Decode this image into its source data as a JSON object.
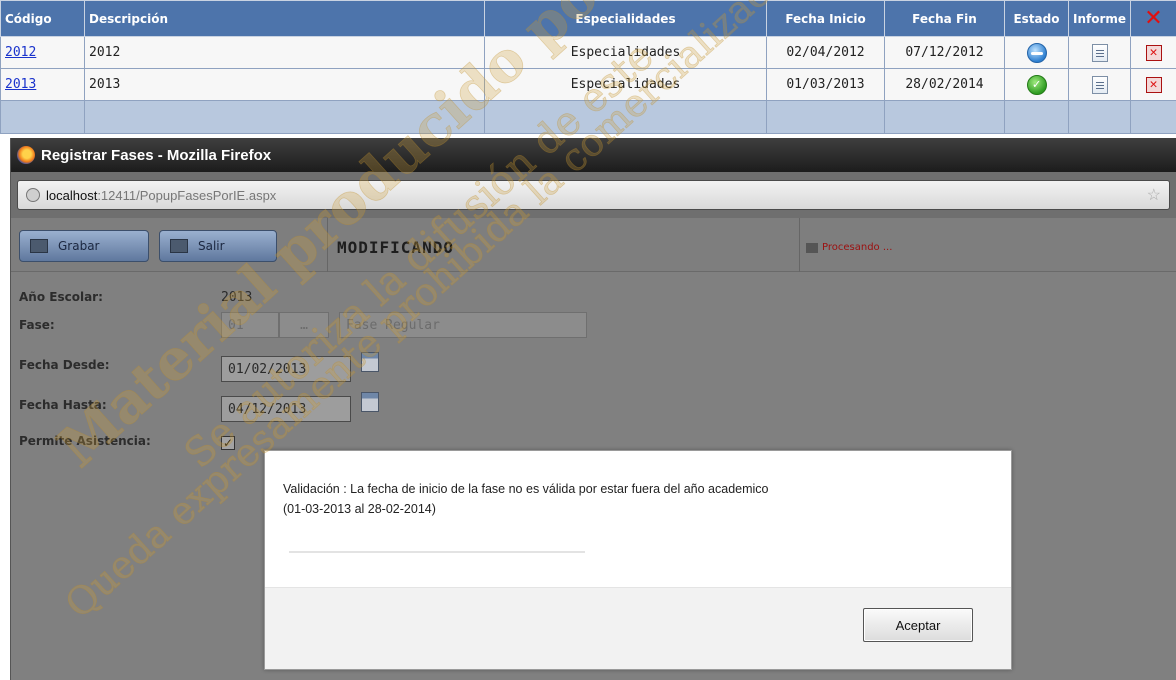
{
  "grid": {
    "headers": {
      "codigo": "Código",
      "descripcion": "Descripción",
      "especialidades": "Especialidades",
      "fecha_inicio": "Fecha Inicio",
      "fecha_fin": "Fecha Fin",
      "estado": "Estado",
      "informe": "Informe"
    },
    "rows": [
      {
        "codigo": "2012",
        "descripcion": "2012",
        "especialidades": "Especialidades",
        "fecha_inicio": "02/04/2012",
        "fecha_fin": "07/12/2012",
        "estado_icon": "blue-minus-icon"
      },
      {
        "codigo": "2013",
        "descripcion": "2013",
        "especialidades": "Especialidades",
        "fecha_inicio": "01/03/2013",
        "fecha_fin": "28/02/2014",
        "estado_icon": "green-check-icon"
      }
    ]
  },
  "window": {
    "title": "Registrar Fases - Mozilla Firefox",
    "url_host": "localhost",
    "url_path": ":12411/PopupFasesPorIE.aspx"
  },
  "toolbar": {
    "grabar_label": "Grabar",
    "salir_label": "Salir",
    "mode": "MODIFICANDO",
    "processing": "Procesando ..."
  },
  "form": {
    "anio_label": "Año Escolar:",
    "anio_value": "2013",
    "fase_label": "Fase:",
    "fase_code": "01",
    "fase_desc": "Fase Regular",
    "fecha_desde_label": "Fecha Desde:",
    "fecha_desde_value": "01/02/2013",
    "fecha_hasta_label": "Fecha Hasta:",
    "fecha_hasta_value": "04/12/2013",
    "asistencia_label": "Permite Asistencia:",
    "asistencia_checked": true
  },
  "modal": {
    "message_line1": "Validación : La fecha de inicio de la fase no es válida por estar fuera del año academico",
    "message_line2": "(01-03-2013 al 28-02-2014)",
    "ok_label": "Aceptar"
  },
  "watermark": {
    "line1": "Material producido por la Oficina",
    "line2": "Se autoriza la difusión de este",
    "line3": "Queda expresamente prohibida la comercialización"
  }
}
